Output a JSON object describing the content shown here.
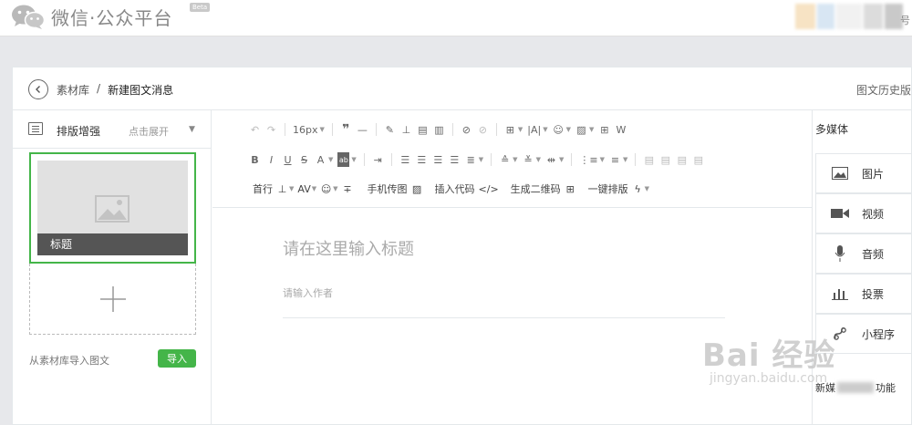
{
  "header": {
    "app_title": "微信·公众平台",
    "beta_badge": "Beta",
    "right_char": "号"
  },
  "breadcrumb": {
    "root": "素材库",
    "separator": "/",
    "current": "新建图文消息",
    "history_link": "图文历史版"
  },
  "left_panel": {
    "layout_enhance": "排版增强",
    "expand": "点击展开",
    "article_title": "标题",
    "import_text": "从素材库导入图文",
    "import_button": "导入"
  },
  "toolbar": {
    "font_size": "16px",
    "indent_label": "首行",
    "mobile_upload": "手机传图",
    "insert_code": "插入代码",
    "code_symbol": "</>",
    "gen_qr": "生成二维码",
    "one_click_layout": "一键排版"
  },
  "editor": {
    "title_placeholder": "请在这里输入标题",
    "author_placeholder": "请输入作者"
  },
  "media_panel": {
    "header": "多媒体",
    "items": [
      {
        "label": "图片",
        "icon": "image-icon"
      },
      {
        "label": "视频",
        "icon": "video-icon"
      },
      {
        "label": "音频",
        "icon": "microphone-icon"
      },
      {
        "label": "投票",
        "icon": "bar-chart-icon"
      },
      {
        "label": "小程序",
        "icon": "link-icon"
      }
    ],
    "new_function_prefix": "新媒",
    "new_function_suffix": "功能"
  },
  "watermark": {
    "main": "Bai 经验",
    "sub": "jingyan.baidu.com"
  },
  "colors": {
    "accent_green": "#44b549",
    "card_overlay": "#3c3c3c"
  }
}
